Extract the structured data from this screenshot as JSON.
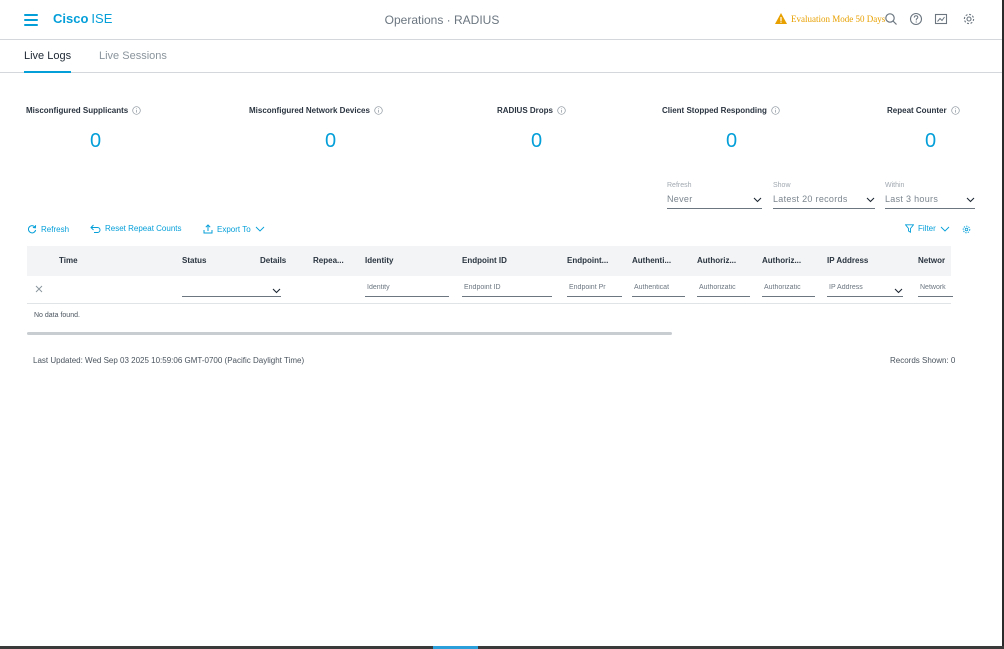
{
  "header": {
    "brand_bold": "Cisco",
    "brand_sub": "ISE",
    "page_title": "Operations · RADIUS",
    "eval_text": "Evaluation Mode 50 Days"
  },
  "tabs": [
    {
      "label": "Live Logs",
      "active": true
    },
    {
      "label": "Live Sessions",
      "active": false
    }
  ],
  "metrics": [
    {
      "label": "Misconfigured Supplicants",
      "value": "0"
    },
    {
      "label": "Misconfigured Network Devices",
      "value": "0"
    },
    {
      "label": "RADIUS Drops",
      "value": "0"
    },
    {
      "label": "Client Stopped Responding",
      "value": "0"
    },
    {
      "label": "Repeat Counter",
      "value": "0"
    }
  ],
  "filters": {
    "refresh": {
      "label": "Refresh",
      "value": "Never"
    },
    "show": {
      "label": "Show",
      "value": "Latest 20 records"
    },
    "within": {
      "label": "Within",
      "value": "Last 3 hours"
    }
  },
  "toolbar": {
    "refresh": "Refresh",
    "reset": "Reset Repeat Counts",
    "export": "Export To",
    "filter": "Filter"
  },
  "table": {
    "columns": [
      "Time",
      "Status",
      "Details",
      "Repea...",
      "Identity",
      "Endpoint ID",
      "Endpoint...",
      "Authenti...",
      "Authoriz...",
      "Authoriz...",
      "IP Address",
      "Networ"
    ],
    "filter_placeholders": [
      "Identity",
      "Endpoint ID",
      "Endpoint Pr",
      "Authenticat",
      "Authorizatic",
      "Authorizatic",
      "IP Address",
      "Network"
    ],
    "empty_text": "No data found."
  },
  "footer": {
    "last_updated": "Last Updated: Wed Sep 03 2025 10:59:06 GMT-0700 (Pacific Daylight Time)",
    "records_shown": "Records Shown: 0"
  },
  "colors": {
    "accent": "#049fd9",
    "warning": "#e8a000"
  }
}
